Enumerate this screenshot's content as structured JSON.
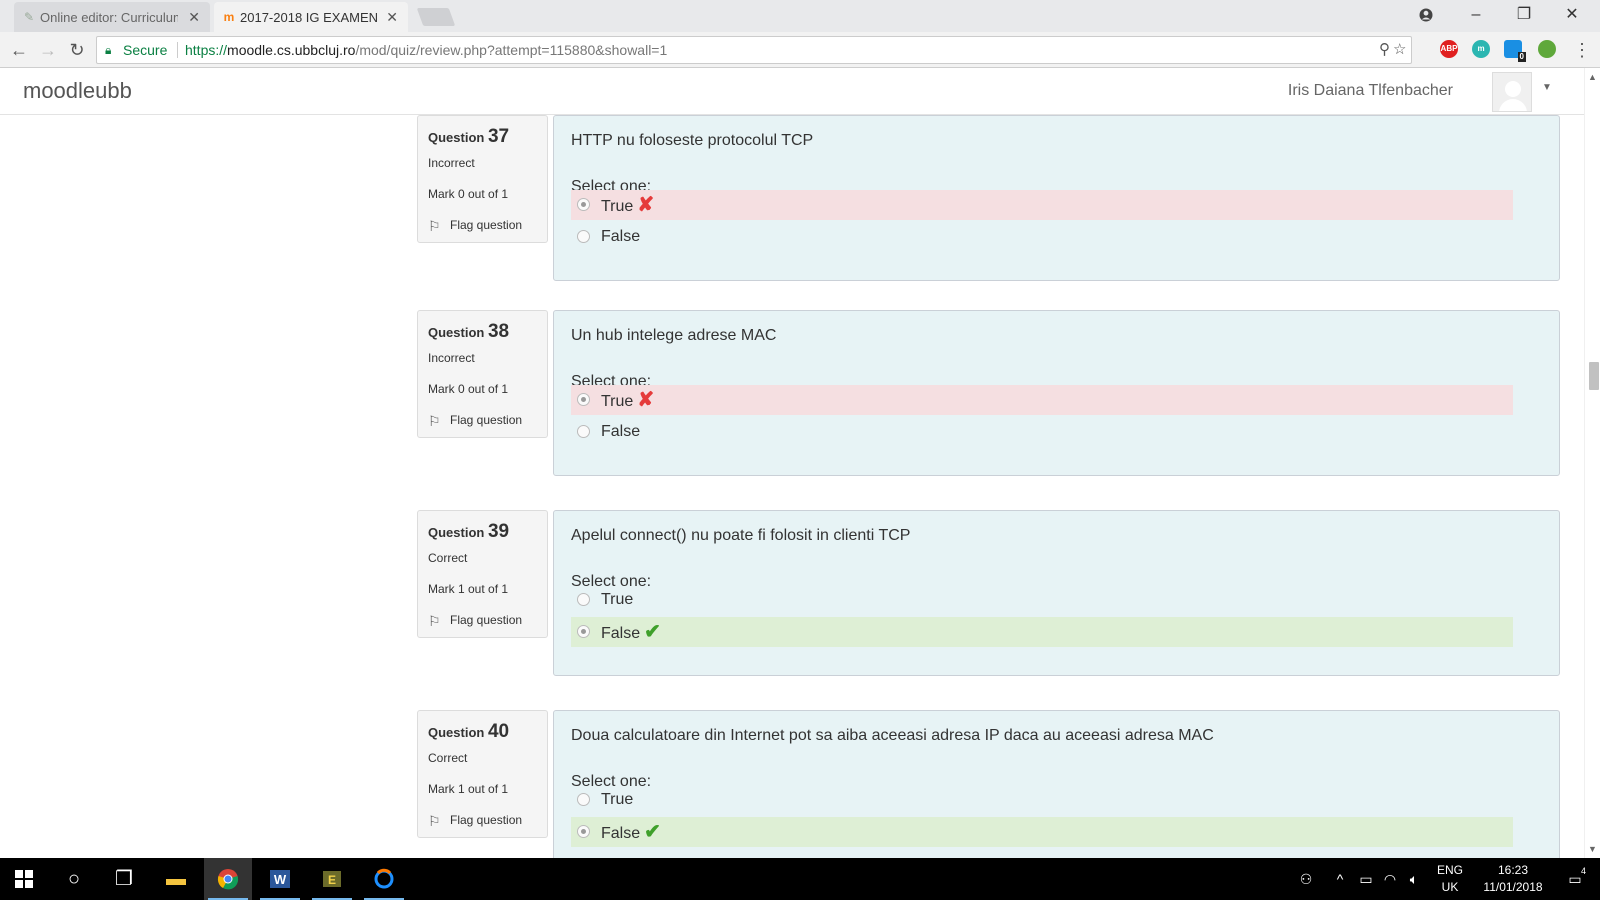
{
  "browser": {
    "tabs": [
      {
        "label": "Online editor: Curriculum",
        "icon": "pencil-icon"
      },
      {
        "label": "2017-2018 IG EXAMEN",
        "icon": "moodle-icon"
      }
    ],
    "address": {
      "secure_label": "Secure",
      "url_scheme": "https://",
      "url_host": "moodle.cs.ubbcluj.ro",
      "url_path": "/mod/quiz/review.php?attempt=115880&showall=1"
    },
    "extensions": {
      "adblock": "ABP",
      "badge": "0"
    }
  },
  "moodle": {
    "brand": "moodleubb",
    "user_name": "Iris Daiana Tlfenbacher"
  },
  "questions": [
    {
      "label": "Question",
      "number": "37",
      "state": "Incorrect",
      "grade": "Mark 0 out of 1",
      "flag": "Flag question",
      "text": "HTTP nu foloseste protocolul TCP",
      "prompt": "Select one:",
      "options": [
        {
          "label": "True",
          "checked": true,
          "result": "incorrect"
        },
        {
          "label": "False",
          "checked": false,
          "result": ""
        }
      ]
    },
    {
      "label": "Question",
      "number": "38",
      "state": "Incorrect",
      "grade": "Mark 0 out of 1",
      "flag": "Flag question",
      "text": "Un hub intelege adrese MAC",
      "prompt": "Select one:",
      "options": [
        {
          "label": "True",
          "checked": true,
          "result": "incorrect"
        },
        {
          "label": "False",
          "checked": false,
          "result": ""
        }
      ]
    },
    {
      "label": "Question",
      "number": "39",
      "state": "Correct",
      "grade": "Mark 1 out of 1",
      "flag": "Flag question",
      "text": "Apelul connect() nu poate fi folosit in clienti TCP",
      "prompt": "Select one:",
      "options": [
        {
          "label": "True",
          "checked": false,
          "result": ""
        },
        {
          "label": "False",
          "checked": true,
          "result": "correct"
        }
      ]
    },
    {
      "label": "Question",
      "number": "40",
      "state": "Correct",
      "grade": "Mark 1 out of 1",
      "flag": "Flag question",
      "text": "Doua calculatoare din Internet pot sa aiba aceeasi adresa IP daca au aceeasi adresa MAC",
      "prompt": "Select one:",
      "options": [
        {
          "label": "True",
          "checked": false,
          "result": ""
        },
        {
          "label": "False",
          "checked": true,
          "result": "correct"
        }
      ]
    }
  ],
  "taskbar": {
    "language": "ENG",
    "region": "UK",
    "time": "16:23",
    "date": "11/01/2018",
    "notifications": "4"
  },
  "colors": {
    "question_bg": "#e7f3f5",
    "incorrect_bg": "#f5dfe1",
    "correct_bg": "#deefd5",
    "secure_green": "#0b8043"
  }
}
